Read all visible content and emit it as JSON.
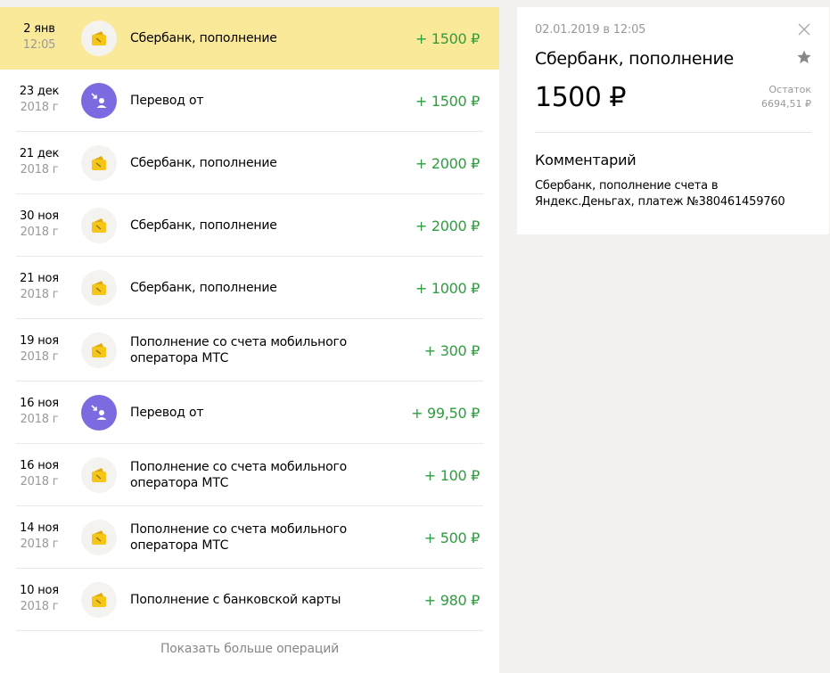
{
  "operations": [
    {
      "date": "2 янв",
      "sub": "12:05",
      "title": "Сбербанк, пополнение",
      "amount": "+ 1500 ₽",
      "icon": "wallet-icon",
      "selected": true
    },
    {
      "date": "23 дек",
      "sub": "2018 г",
      "title": "Перевод от",
      "amount": "+ 1500 ₽",
      "icon": "transfer-icon",
      "selected": false
    },
    {
      "date": "21 дек",
      "sub": "2018 г",
      "title": "Сбербанк, пополнение",
      "amount": "+ 2000 ₽",
      "icon": "wallet-icon",
      "selected": false
    },
    {
      "date": "30 ноя",
      "sub": "2018 г",
      "title": "Сбербанк, пополнение",
      "amount": "+ 2000 ₽",
      "icon": "wallet-icon",
      "selected": false
    },
    {
      "date": "21 ноя",
      "sub": "2018 г",
      "title": "Сбербанк, пополнение",
      "amount": "+ 1000 ₽",
      "icon": "wallet-icon",
      "selected": false
    },
    {
      "date": "19 ноя",
      "sub": "2018 г",
      "title": "Пополнение со счета мобильного оператора МТС",
      "amount": "+ 300 ₽",
      "icon": "wallet-icon",
      "selected": false
    },
    {
      "date": "16 ноя",
      "sub": "2018 г",
      "title": "Перевод от",
      "amount": "+ 99,50 ₽",
      "icon": "transfer-icon",
      "selected": false
    },
    {
      "date": "16 ноя",
      "sub": "2018 г",
      "title": "Пополнение со счета мобильного оператора МТС",
      "amount": "+ 100 ₽",
      "icon": "wallet-icon",
      "selected": false
    },
    {
      "date": "14 ноя",
      "sub": "2018 г",
      "title": "Пополнение со счета мобильного оператора МТС",
      "amount": "+ 500 ₽",
      "icon": "wallet-icon",
      "selected": false
    },
    {
      "date": "10 ноя",
      "sub": "2018 г",
      "title": "Пополнение с банковской карты",
      "amount": "+ 980 ₽",
      "icon": "wallet-icon",
      "selected": false
    }
  ],
  "show_more_label": "Показать больше операций",
  "details": {
    "datetime": "02.01.2019 в 12:05",
    "title": "Сбербанк, пополнение",
    "amount": "1500 ₽",
    "balance_label": "Остаток",
    "balance_value": "6694,51 ₽",
    "comment_heading": "Комментарий",
    "comment_text": "Сбербанк, пополнение счета в Яндекс.Деньгах, платеж №380461459760",
    "close_icon": "close-icon",
    "star_icon": "star-icon"
  },
  "colors": {
    "selected_row": "#fbe99a",
    "amount_positive": "#2c9e3d",
    "transfer_icon_bg": "#7a6ce0",
    "wallet_icon": "#f5c518",
    "page_bg": "#f2f1ef"
  }
}
